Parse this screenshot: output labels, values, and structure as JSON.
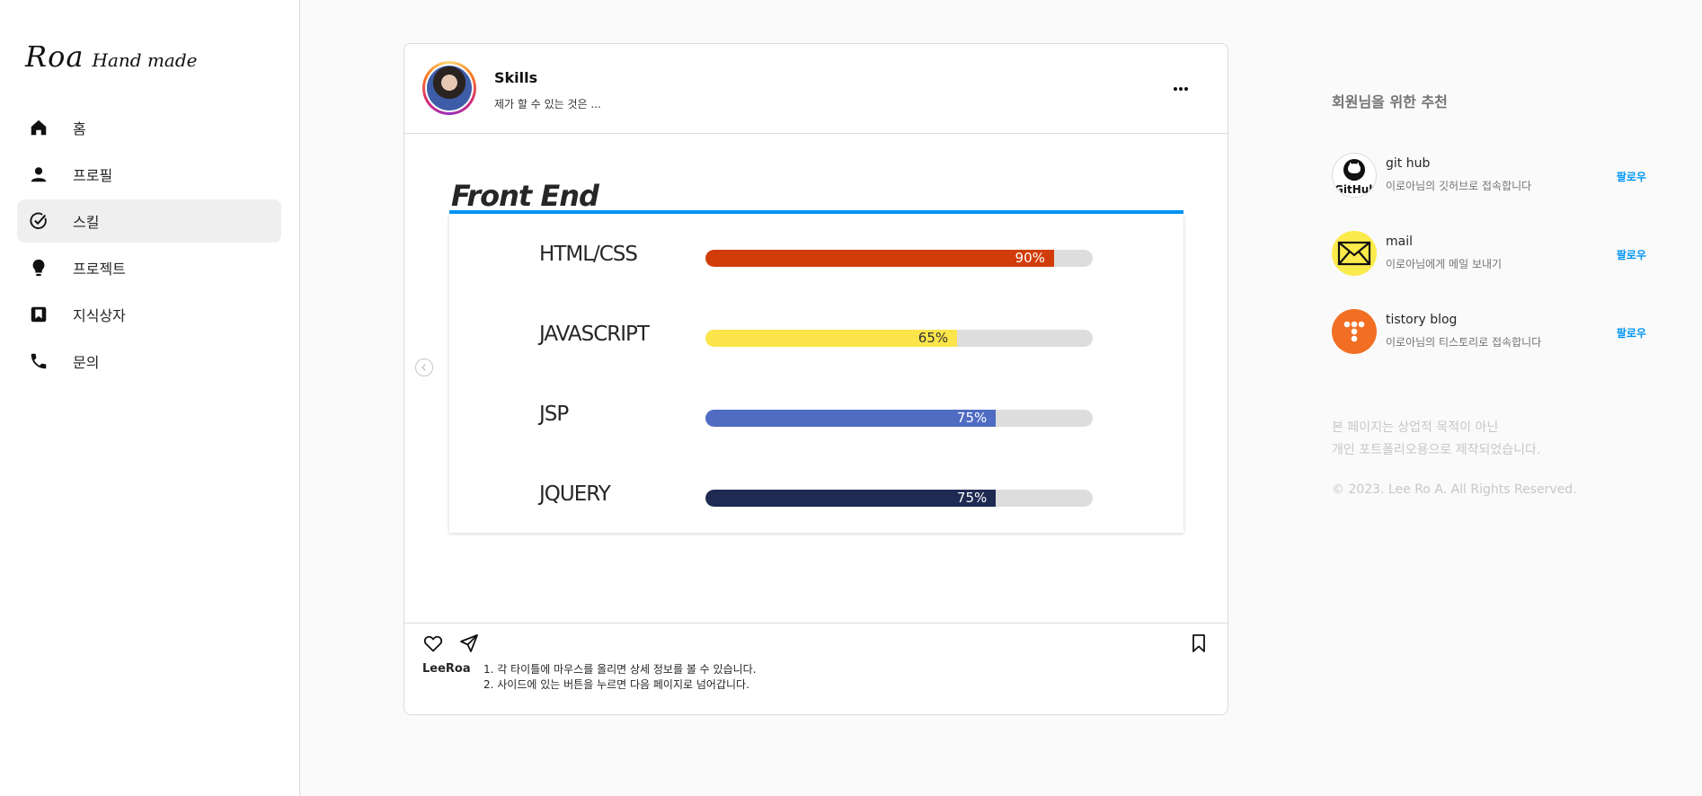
{
  "brand": {
    "logo_main": "Roa",
    "logo_sub": "Hand made"
  },
  "sidebar": {
    "items": [
      {
        "label": "홈",
        "icon": "home-icon"
      },
      {
        "label": "프로필",
        "icon": "person-icon"
      },
      {
        "label": "스킬",
        "icon": "check-circle-icon",
        "active": true
      },
      {
        "label": "프로젝트",
        "icon": "lightbulb-icon"
      },
      {
        "label": "지식상자",
        "icon": "bookmark-box-icon"
      },
      {
        "label": "문의",
        "icon": "phone-icon"
      }
    ]
  },
  "post": {
    "title": "Skills",
    "subtitle": "제가 할 수 있는 것은 ...",
    "section_title": "Front End",
    "skills": [
      {
        "name": "HTML/CSS",
        "percent": 90,
        "label": "90%",
        "color": "#d13d0a"
      },
      {
        "name": "JAVASCRIPT",
        "percent": 65,
        "label": "65%",
        "color": "#fbe54a"
      },
      {
        "name": "JSP",
        "percent": 75,
        "label": "75%",
        "color": "#4f6bc2"
      },
      {
        "name": "JQUERY",
        "percent": 75,
        "label": "75%",
        "color": "#1e2a52"
      }
    ],
    "caption_user": "LeeRoa",
    "caption_lines": [
      "1. 각 타이틀에 마우스를 올리면 상세 정보를 볼 수 있습니다.",
      "2. 사이드에 있는 버튼을 누르면 다음 페이지로 넘어갑니다."
    ]
  },
  "recommend": {
    "title": "회원님을 위한 추천",
    "follow_label": "팔로우",
    "items": [
      {
        "name": "git hub",
        "desc": "이로아님의 깃허브로 접속합니다"
      },
      {
        "name": "mail",
        "desc": "이로아님에게 메일 보내기"
      },
      {
        "name": "tistory blog",
        "desc": "이로아님의 티스토리로 접속합니다"
      }
    ]
  },
  "footer": {
    "note_line1": "본 페이지는 상업적 목적이 아닌",
    "note_line2": "개인 포트폴리오용으로 제작되었습니다.",
    "copyright": "© 2023. Lee Ro A. All Rights Reserved."
  },
  "colors": {
    "accent": "#0095f6",
    "border": "#dbdbdb",
    "track": "#dddddd"
  }
}
